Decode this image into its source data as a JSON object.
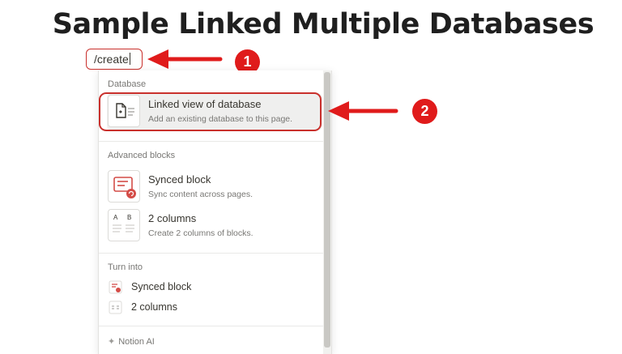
{
  "page": {
    "title": "Sample Linked Multiple Databases"
  },
  "command_input": {
    "value": "/create"
  },
  "annotations": {
    "step1": "1",
    "step2": "2",
    "accent_color": "#e01b1b"
  },
  "menu": {
    "sections": [
      {
        "label": "Database",
        "items": [
          {
            "name": "Linked view of database",
            "description": "Add an existing database to this page.",
            "icon": "linked-database-icon",
            "selected": true
          }
        ]
      },
      {
        "label": "Advanced blocks",
        "items": [
          {
            "name": "Synced block",
            "description": "Sync content across pages.",
            "icon": "synced-block-icon"
          },
          {
            "name": "2 columns",
            "description": "Create 2 columns of blocks.",
            "icon": "two-columns-icon",
            "thumb_text_a": "A",
            "thumb_text_b": "B"
          }
        ]
      },
      {
        "label": "Turn into",
        "items": [
          {
            "name": "Synced block",
            "icon": "synced-block-icon"
          },
          {
            "name": "2 columns",
            "icon": "two-columns-icon"
          }
        ]
      }
    ],
    "footer": {
      "label": "Notion AI",
      "icon": "sparkle-icon"
    }
  }
}
